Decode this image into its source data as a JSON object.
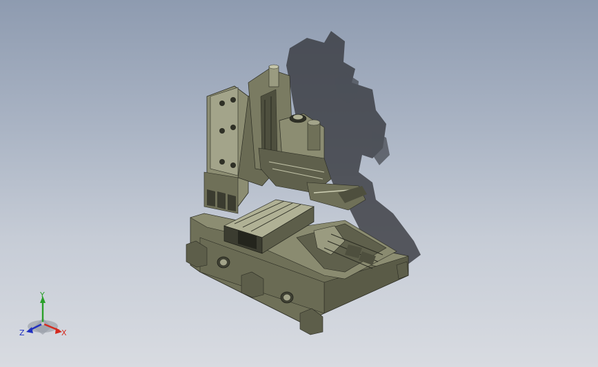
{
  "viewport": {
    "background_top": "#8e9bb0",
    "background_bottom": "#d8dbe1"
  },
  "model": {
    "body_color": "#6f7058",
    "light_face_color": "#a3a48a",
    "dark_face_color": "#4e4f3e",
    "shadow_color": "#3a3c42"
  },
  "triad": {
    "x_label": "X",
    "y_label": "Y",
    "z_label": "Z",
    "x_color": "#d42a1e",
    "y_color": "#2aa02a",
    "z_color": "#2030c0"
  }
}
